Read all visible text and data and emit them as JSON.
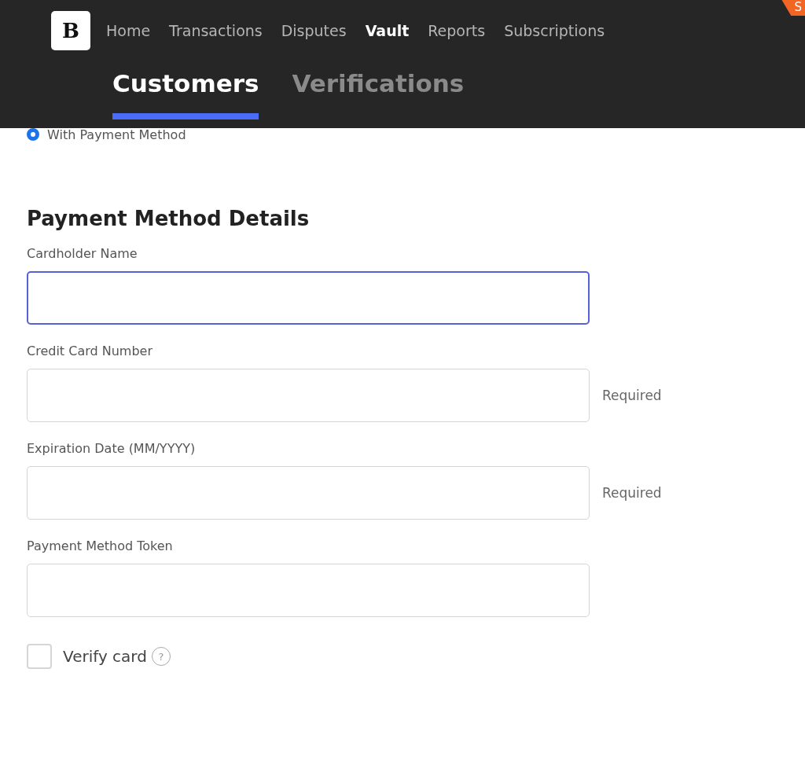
{
  "header": {
    "logo": "B",
    "nav": [
      {
        "label": "Home",
        "selected": false
      },
      {
        "label": "Transactions",
        "selected": false
      },
      {
        "label": "Disputes",
        "selected": false
      },
      {
        "label": "Vault",
        "selected": true
      },
      {
        "label": "Reports",
        "selected": false
      },
      {
        "label": "Subscriptions",
        "selected": false
      }
    ],
    "badge": "S",
    "tabs": [
      {
        "label": "Customers",
        "selected": true
      },
      {
        "label": "Verifications",
        "selected": false
      }
    ]
  },
  "radio": {
    "label": "With Payment Method",
    "selected": true
  },
  "section_title": "Payment Method Details",
  "fields": [
    {
      "label": "Cardholder Name",
      "focused": true
    },
    {
      "label": "Credit Card Number",
      "focused": false,
      "note": "Required"
    },
    {
      "label": "Expiration Date (MM/YYYY)",
      "focused": false,
      "note": "Required"
    },
    {
      "label": "Payment Method Token",
      "focused": false
    }
  ],
  "verify": {
    "label": "Verify card",
    "checked": false,
    "help": "?"
  }
}
